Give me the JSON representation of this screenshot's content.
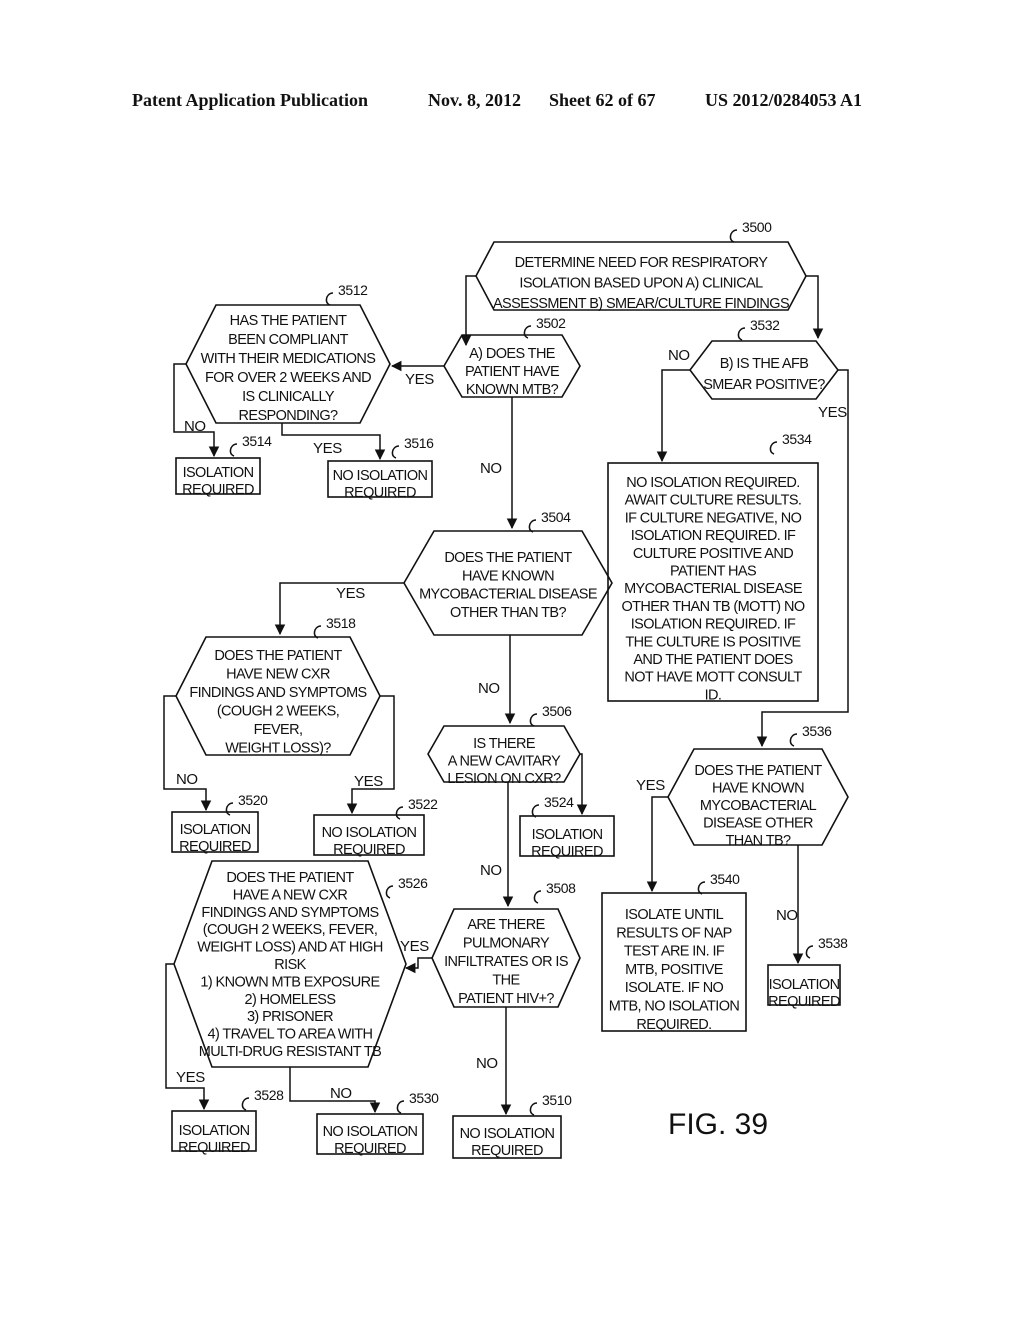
{
  "header": {
    "publication": "Patent Application Publication",
    "date": "Nov. 8, 2012",
    "sheet": "Sheet 62 of 67",
    "number": "US 2012/0284053 A1"
  },
  "figure_label": "FIG. 39",
  "nodes": {
    "n3500": {
      "ref": "3500",
      "type": "hexagon",
      "lines": [
        "DETERMINE NEED FOR RESPIRATORY",
        "ISOLATION BASED UPON A) CLINICAL",
        "ASSESSMENT B) SMEAR/CULTURE FINDINGS"
      ]
    },
    "n3502": {
      "ref": "3502",
      "type": "hexagon",
      "lines": [
        "A) DOES THE",
        "PATIENT HAVE",
        "KNOWN MTB?"
      ]
    },
    "n3512": {
      "ref": "3512",
      "type": "hexagon",
      "lines": [
        "HAS THE PATIENT",
        "BEEN COMPLIANT",
        "WITH THEIR MEDICATIONS",
        "FOR OVER 2 WEEKS AND",
        "IS CLINICALLY",
        "RESPONDING?"
      ]
    },
    "n3514": {
      "ref": "3514",
      "type": "box",
      "lines": [
        "ISOLATION",
        "REQUIRED"
      ]
    },
    "n3516": {
      "ref": "3516",
      "type": "box",
      "lines": [
        "NO ISOLATION",
        "REQUIRED"
      ]
    },
    "n3532": {
      "ref": "3532",
      "type": "hexagon",
      "lines": [
        "B) IS THE AFB",
        "SMEAR POSITIVE?"
      ]
    },
    "n3534": {
      "ref": "3534",
      "type": "box",
      "lines": [
        "NO ISOLATION REQUIRED.",
        "AWAIT CULTURE RESULTS.",
        "IF CULTURE NEGATIVE, NO",
        "ISOLATION REQUIRED.  IF",
        "CULTURE POSITIVE AND",
        "PATIENT HAS",
        "MYCOBACTERIAL DISEASE",
        "OTHER THAN TB (MOTT) NO",
        "ISOLATION REQUIRED.  IF",
        "THE CULTURE IS POSITIVE",
        "AND THE PATIENT DOES",
        "NOT HAVE MOTT CONSULT",
        "ID."
      ]
    },
    "n3504": {
      "ref": "3504",
      "type": "hexagon",
      "lines": [
        "DOES THE PATIENT",
        "HAVE KNOWN",
        "MYCOBACTERIAL DISEASE",
        "OTHER THAN TB?"
      ]
    },
    "n3518": {
      "ref": "3518",
      "type": "hexagon",
      "lines": [
        "DOES THE PATIENT",
        "HAVE NEW CXR",
        "FINDINGS AND SYMPTOMS",
        "(COUGH 2 WEEKS,",
        "FEVER,",
        "WEIGHT LOSS)?"
      ]
    },
    "n3520": {
      "ref": "3520",
      "type": "box",
      "lines": [
        "ISOLATION",
        "REQUIRED"
      ]
    },
    "n3522": {
      "ref": "3522",
      "type": "box",
      "lines": [
        "NO ISOLATION",
        "REQUIRED"
      ]
    },
    "n3506": {
      "ref": "3506",
      "type": "hexagon",
      "lines": [
        "IS THERE",
        "A NEW CAVITARY",
        "LESION ON CXR?"
      ]
    },
    "n3524": {
      "ref": "3524",
      "type": "box",
      "lines": [
        "ISOLATION",
        "REQUIRED"
      ]
    },
    "n3536": {
      "ref": "3536",
      "type": "hexagon",
      "lines": [
        "DOES THE PATIENT",
        "HAVE KNOWN",
        "MYCOBACTERIAL",
        "DISEASE OTHER",
        "THAN TB?"
      ]
    },
    "n3540": {
      "ref": "3540",
      "type": "box",
      "lines": [
        "ISOLATE UNTIL",
        "RESULTS OF NAP",
        "TEST ARE IN.  IF",
        "MTB, POSITIVE",
        "ISOLATE.  IF NO",
        "MTB, NO ISOLATION",
        "REQUIRED."
      ]
    },
    "n3538": {
      "ref": "3538",
      "type": "box",
      "lines": [
        "ISOLATION",
        "REQUIRED"
      ]
    },
    "n3526": {
      "ref": "3526",
      "type": "hexagon",
      "lines": [
        "DOES THE PATIENT",
        "HAVE A NEW CXR",
        "FINDINGS AND SYMPTOMS",
        "(COUGH 2 WEEKS, FEVER,",
        "WEIGHT LOSS) AND AT HIGH",
        "RISK",
        "1) KNOWN MTB EXPOSURE",
        "2) HOMELESS",
        "3) PRISONER",
        "4) TRAVEL TO AREA WITH",
        "MULTI-DRUG RESISTANT TB"
      ]
    },
    "n3508": {
      "ref": "3508",
      "type": "hexagon",
      "lines": [
        "ARE THERE",
        "PULMONARY",
        "INFILTRATES OR IS",
        "THE",
        "PATIENT HIV+?"
      ]
    },
    "n3528": {
      "ref": "3528",
      "type": "box",
      "lines": [
        "ISOLATION",
        "REQUIRED"
      ]
    },
    "n3530": {
      "ref": "3530",
      "type": "box",
      "lines": [
        "NO ISOLATION",
        "REQUIRED"
      ]
    },
    "n3510": {
      "ref": "3510",
      "type": "box",
      "lines": [
        "NO ISOLATION",
        "REQUIRED"
      ]
    }
  },
  "edges": [
    {
      "from": "3500",
      "to": "3502",
      "label": ""
    },
    {
      "from": "3500",
      "to": "3532",
      "label": ""
    },
    {
      "from": "3502",
      "to": "3512",
      "label": "YES"
    },
    {
      "from": "3502",
      "to": "3504",
      "label": "NO"
    },
    {
      "from": "3512",
      "to": "3514",
      "label": "NO"
    },
    {
      "from": "3512",
      "to": "3516",
      "label": "YES"
    },
    {
      "from": "3532",
      "to": "3534",
      "label": "NO"
    },
    {
      "from": "3532",
      "to": "3536",
      "label": "YES"
    },
    {
      "from": "3504",
      "to": "3518",
      "label": "YES"
    },
    {
      "from": "3504",
      "to": "3506",
      "label": "NO"
    },
    {
      "from": "3518",
      "to": "3520",
      "label": "NO"
    },
    {
      "from": "3518",
      "to": "3522",
      "label": "YES"
    },
    {
      "from": "3506",
      "to": "3524",
      "label": ""
    },
    {
      "from": "3506",
      "to": "3508",
      "label": "NO"
    },
    {
      "from": "3536",
      "to": "3540",
      "label": "YES"
    },
    {
      "from": "3536",
      "to": "3538",
      "label": "NO"
    },
    {
      "from": "3508",
      "to": "3526",
      "label": "YES"
    },
    {
      "from": "3508",
      "to": "3510",
      "label": "NO"
    },
    {
      "from": "3526",
      "to": "3528",
      "label": "YES"
    },
    {
      "from": "3526",
      "to": "3530",
      "label": "NO"
    }
  ],
  "edge_labels": {
    "yes_3502": "YES",
    "no_3502": "NO",
    "no_3512": "NO",
    "yes_3512": "YES",
    "no_3532": "NO",
    "yes_3532": "YES",
    "yes_3504": "YES",
    "no_3504": "NO",
    "no_3518": "NO",
    "yes_3518": "YES",
    "no_3506": "NO",
    "yes_3536": "YES",
    "no_3536": "NO",
    "yes_3508": "YES",
    "no_3508": "NO",
    "yes_3526": "YES",
    "no_3526": "NO"
  }
}
